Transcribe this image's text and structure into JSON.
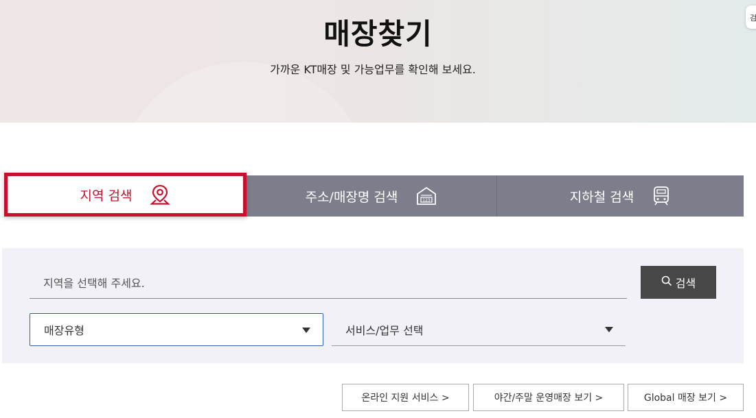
{
  "hero": {
    "title": "매장찾기",
    "subtitle": "가까운 KT매장 및 가능업무를 확인해 보세요.",
    "side_chip": "검"
  },
  "tabs": [
    {
      "label": "지역 검색",
      "icon": "map-pin-icon",
      "active": true
    },
    {
      "label": "주소/매장명 검색",
      "icon": "address-123-icon",
      "active": false
    },
    {
      "label": "지하철 검색",
      "icon": "subway-train-icon",
      "active": false
    }
  ],
  "search": {
    "region_placeholder": "지역을 선택해 주세요.",
    "search_label": "검색",
    "store_type_selected": "매장유형",
    "service_selected": "서비스/업무 선택"
  },
  "links": [
    "온라인 지원 서비스 >",
    "야간/주말 운영매장 보기 >",
    "Global 매장 보기 >"
  ],
  "colors": {
    "accent_red": "#c8102e",
    "tab_gray": "#7d7e8c",
    "panel_bg": "#f1f1f7",
    "search_button": "#474747",
    "focus_blue": "#2f5fb3"
  }
}
